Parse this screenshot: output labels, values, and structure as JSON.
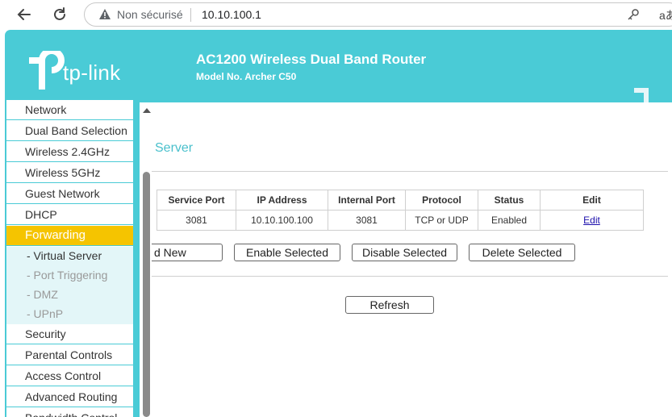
{
  "browser": {
    "security_label": "Non sécurisé",
    "url": "10.10.100.1",
    "reader_glyph": "aあ"
  },
  "router": {
    "logo_text": "tp-link",
    "title": "AC1200 Wireless Dual Band Router",
    "model": "Model No. Archer C50",
    "accent_color": "#4acbd6",
    "active_color": "#f5c400"
  },
  "sidebar": {
    "items": [
      {
        "label": "Network"
      },
      {
        "label": "Dual Band Selection"
      },
      {
        "label": "Wireless 2.4GHz"
      },
      {
        "label": "Wireless 5GHz"
      },
      {
        "label": "Guest Network"
      },
      {
        "label": "DHCP"
      },
      {
        "label": "Forwarding"
      },
      {
        "label": "Security"
      },
      {
        "label": "Parental Controls"
      },
      {
        "label": "Access Control"
      },
      {
        "label": "Advanced Routing"
      },
      {
        "label": "Bandwidth Control"
      }
    ],
    "subitems": [
      {
        "label": "- Virtual Server"
      },
      {
        "label": "- Port Triggering"
      },
      {
        "label": "- DMZ"
      },
      {
        "label": "- UPnP"
      }
    ]
  },
  "content": {
    "page_title": "Server",
    "table": {
      "headers": [
        "Service Port",
        "IP Address",
        "Internal Port",
        "Protocol",
        "Status",
        "Edit"
      ],
      "rows": [
        {
          "service_port": "3081",
          "ip_address": "10.10.100.100",
          "internal_port": "3081",
          "protocol": "TCP or UDP",
          "status": "Enabled",
          "edit": "Edit"
        }
      ]
    },
    "buttons": {
      "add_new": "d New",
      "enable_selected": "Enable Selected",
      "disable_selected": "Disable Selected",
      "delete_selected": "Delete Selected",
      "refresh": "Refresh"
    }
  }
}
